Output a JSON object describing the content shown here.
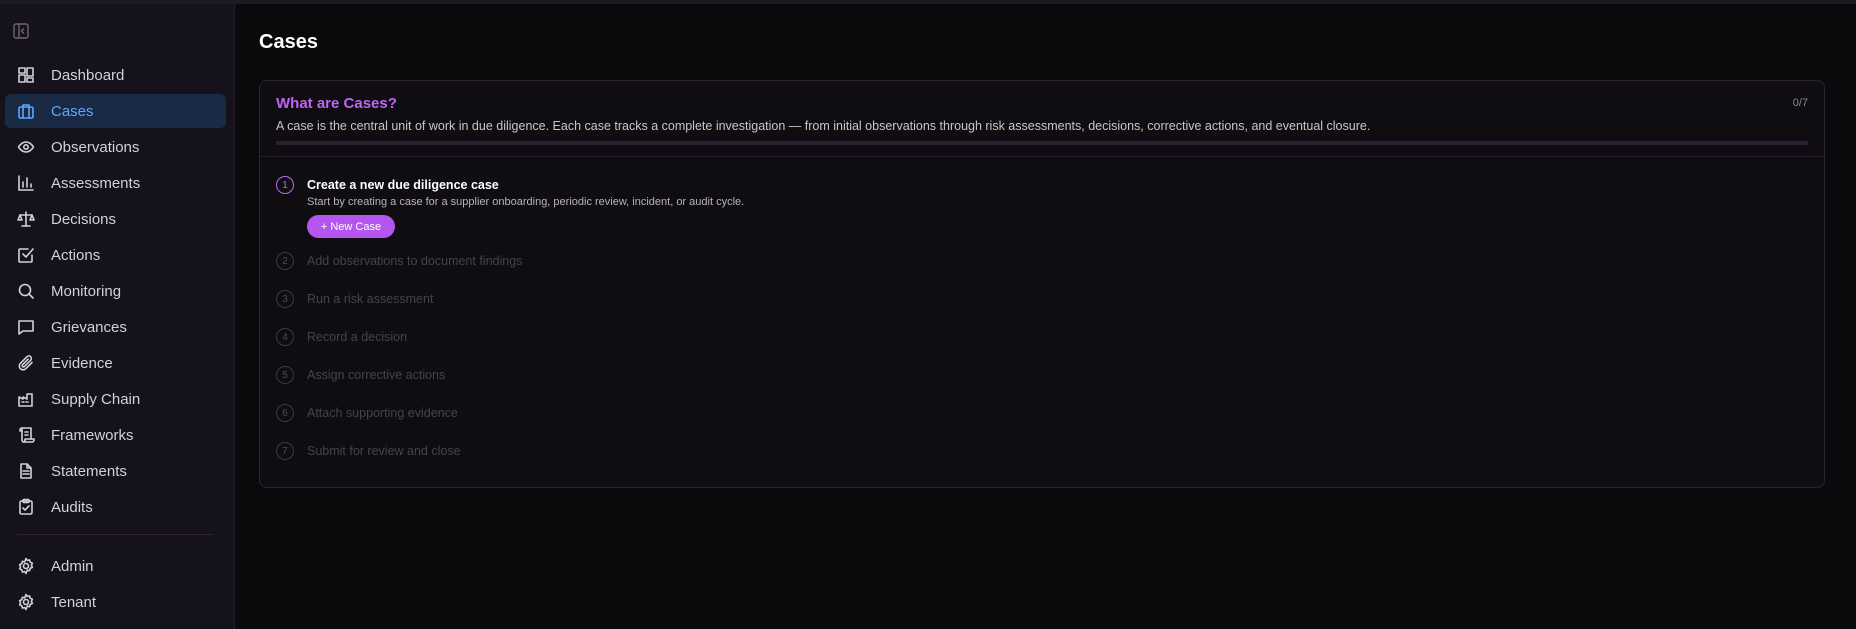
{
  "sidebar": {
    "items": [
      {
        "label": "Dashboard",
        "icon": "dashboard-icon"
      },
      {
        "label": "Cases",
        "icon": "briefcase-icon",
        "active": true
      },
      {
        "label": "Observations",
        "icon": "eye-icon"
      },
      {
        "label": "Assessments",
        "icon": "bar-chart-icon"
      },
      {
        "label": "Decisions",
        "icon": "scale-icon"
      },
      {
        "label": "Actions",
        "icon": "checkbox-icon"
      },
      {
        "label": "Monitoring",
        "icon": "search-icon"
      },
      {
        "label": "Grievances",
        "icon": "message-icon"
      },
      {
        "label": "Evidence",
        "icon": "paperclip-icon"
      },
      {
        "label": "Supply Chain",
        "icon": "factory-icon"
      },
      {
        "label": "Frameworks",
        "icon": "scroll-icon"
      },
      {
        "label": "Statements",
        "icon": "file-text-icon"
      },
      {
        "label": "Audits",
        "icon": "clipboard-check-icon"
      }
    ],
    "bottom_items": [
      {
        "label": "Admin",
        "icon": "gear-icon"
      },
      {
        "label": "Tenant",
        "icon": "gear-icon"
      }
    ]
  },
  "main": {
    "title": "Cases",
    "guide": {
      "title": "What are Cases?",
      "count": "0/7",
      "progress": 0,
      "description": "A case is the central unit of work in due diligence. Each case tracks a complete investigation — from initial observations through risk assessments, decisions, corrective actions, and eventual closure.",
      "steps": [
        {
          "num": "1",
          "title": "Create a new due diligence case",
          "desc": "Start by creating a case for a supplier onboarding, periodic review, incident, or audit cycle.",
          "button": "+ New Case"
        },
        {
          "num": "2",
          "title": "Add observations to document findings"
        },
        {
          "num": "3",
          "title": "Run a risk assessment"
        },
        {
          "num": "4",
          "title": "Record a decision"
        },
        {
          "num": "5",
          "title": "Assign corrective actions"
        },
        {
          "num": "6",
          "title": "Attach supporting evidence"
        },
        {
          "num": "7",
          "title": "Submit for review and close"
        }
      ]
    }
  },
  "colors": {
    "accent": "#b456ee",
    "active_nav_bg": "#1a2a45",
    "active_nav_text": "#5ea6ff",
    "background": "#0a090b",
    "sidebar_bg": "#16121b"
  }
}
